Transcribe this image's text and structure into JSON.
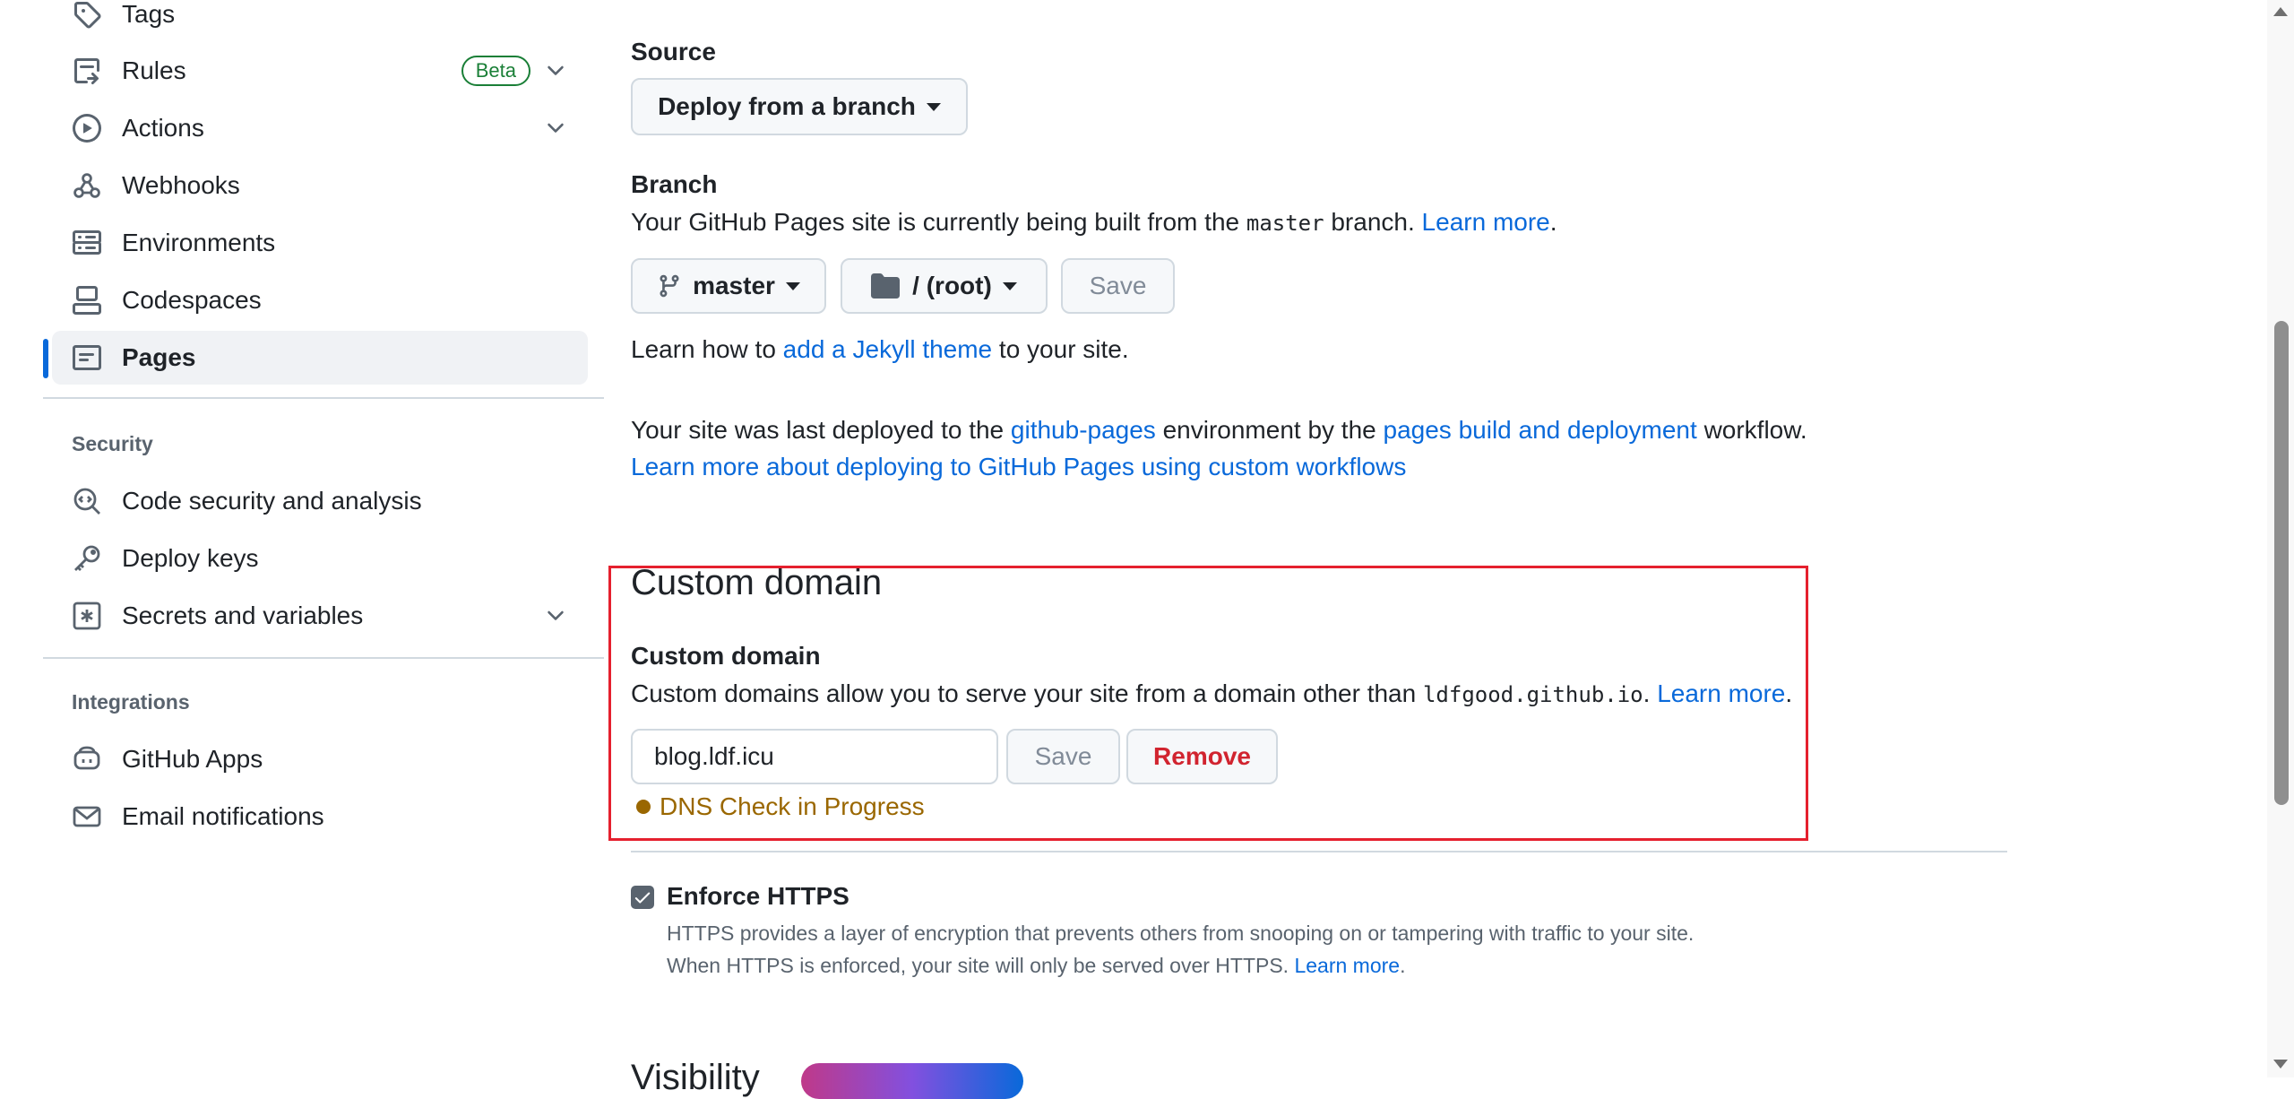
{
  "sidebar": {
    "items": [
      {
        "label": "Tags",
        "icon": "tag-icon"
      },
      {
        "label": "Rules",
        "icon": "rules-icon",
        "badge": "Beta",
        "expandable": true
      },
      {
        "label": "Actions",
        "icon": "play-icon",
        "expandable": true
      },
      {
        "label": "Webhooks",
        "icon": "webhook-icon"
      },
      {
        "label": "Environments",
        "icon": "server-icon"
      },
      {
        "label": "Codespaces",
        "icon": "codespaces-icon"
      },
      {
        "label": "Pages",
        "icon": "browser-icon",
        "active": true
      }
    ],
    "security_heading": "Security",
    "security_items": [
      {
        "label": "Code security and analysis",
        "icon": "codescan-icon"
      },
      {
        "label": "Deploy keys",
        "icon": "key-icon"
      },
      {
        "label": "Secrets and variables",
        "icon": "asterisk-icon",
        "expandable": true
      }
    ],
    "integrations_heading": "Integrations",
    "integrations_items": [
      {
        "label": "GitHub Apps",
        "icon": "copilot-icon"
      },
      {
        "label": "Email notifications",
        "icon": "mail-icon"
      }
    ]
  },
  "source": {
    "label": "Source",
    "dropdown": "Deploy from a branch"
  },
  "branch": {
    "label": "Branch",
    "text_before": "Your GitHub Pages site is currently being built from the",
    "branch_code": "master",
    "text_after": "branch.",
    "learn_more": "Learn more",
    "period": ".",
    "branch_button": "master",
    "folder_button": "/ (root)",
    "save_button": "Save"
  },
  "jekyll": {
    "text_before": "Learn how to",
    "link": "add a Jekyll theme",
    "text_after": "to your site."
  },
  "deployment": {
    "text1": "Your site was last deployed to the",
    "env_link": "github-pages",
    "text2": "environment by the",
    "workflow_link": "pages build and deployment",
    "text3": "workflow.",
    "custom_workflows_link": "Learn more about deploying to GitHub Pages using custom workflows"
  },
  "custom_domain": {
    "heading": "Custom domain",
    "label": "Custom domain",
    "desc_before": "Custom domains allow you to serve your site from a domain other than",
    "desc_code": "ldfgood.github.io",
    "desc_period": ".",
    "learn_more": "Learn more",
    "learn_more_period": ".",
    "input_value": "blog.ldf.icu",
    "save_button": "Save",
    "remove_button": "Remove",
    "dns_status": "DNS Check in Progress",
    "highlight_color": "#e5202e"
  },
  "https": {
    "label": "Enforce HTTPS",
    "checked": true,
    "desc_line1": "HTTPS provides a layer of encryption that prevents others from snooping on or tampering with traffic to your site.",
    "desc_line2": "When HTTPS is enforced, your site will only be served over HTTPS.",
    "learn_more": "Learn more",
    "learn_more_period": "."
  },
  "visibility": {
    "heading": "Visibility"
  },
  "colors": {
    "link": "#0969da",
    "dns_warning": "#9a6700",
    "danger": "#d1242f",
    "active_accent": "#0969da"
  }
}
